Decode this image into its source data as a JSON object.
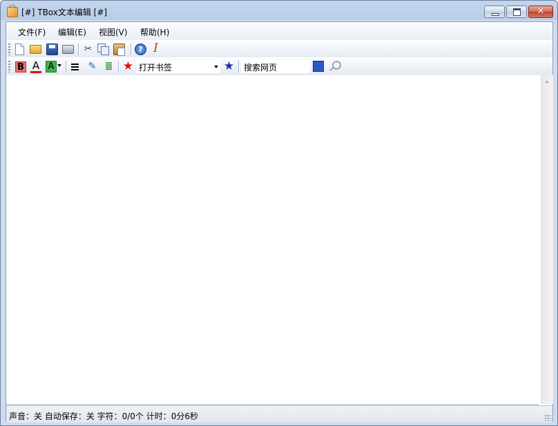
{
  "window": {
    "title": "[#] TBox文本编辑 [#]",
    "close_glyph": "✕"
  },
  "menu": {
    "items": [
      "文件(F)",
      "编辑(E)",
      "视图(V)",
      "帮助(H)"
    ]
  },
  "toolbar": {
    "help_glyph": "?",
    "font_glyph": "I",
    "cut_glyph": "✂",
    "bold_glyph": "B",
    "font_color_glyph": "A",
    "highlight_glyph": "A",
    "indent_glyph": "✎",
    "tree_glyph": "≣",
    "star_glyph": "★",
    "baidu_glyph": "🐾",
    "bookmark": {
      "value": "打开书签"
    },
    "search": {
      "value": "搜索网页"
    }
  },
  "status": {
    "text": "声音：关  自动保存：关  字符：0/0个  计时：0分6秒"
  },
  "icons": [
    "app-icon",
    "minimize-icon",
    "maximize-icon",
    "close-icon",
    "new-file-icon",
    "open-folder-icon",
    "save-icon",
    "print-icon",
    "cut-icon",
    "copy-icon",
    "paste-icon",
    "help-icon",
    "font-icon",
    "bold-icon",
    "font-color-icon",
    "highlight-icon",
    "align-icon",
    "indent-icon",
    "tree-icon",
    "add-bookmark-star-icon",
    "bookmark-star-icon",
    "baidu-paw-icon",
    "magnifier-icon"
  ],
  "colors": {
    "title_bar": "#b9cde8",
    "close_button": "#c4402a",
    "bold_bg": "#e8706a",
    "highlight_bg": "#3bb34a",
    "star_red": "#dd1111",
    "star_blue": "#1a2fa8"
  }
}
